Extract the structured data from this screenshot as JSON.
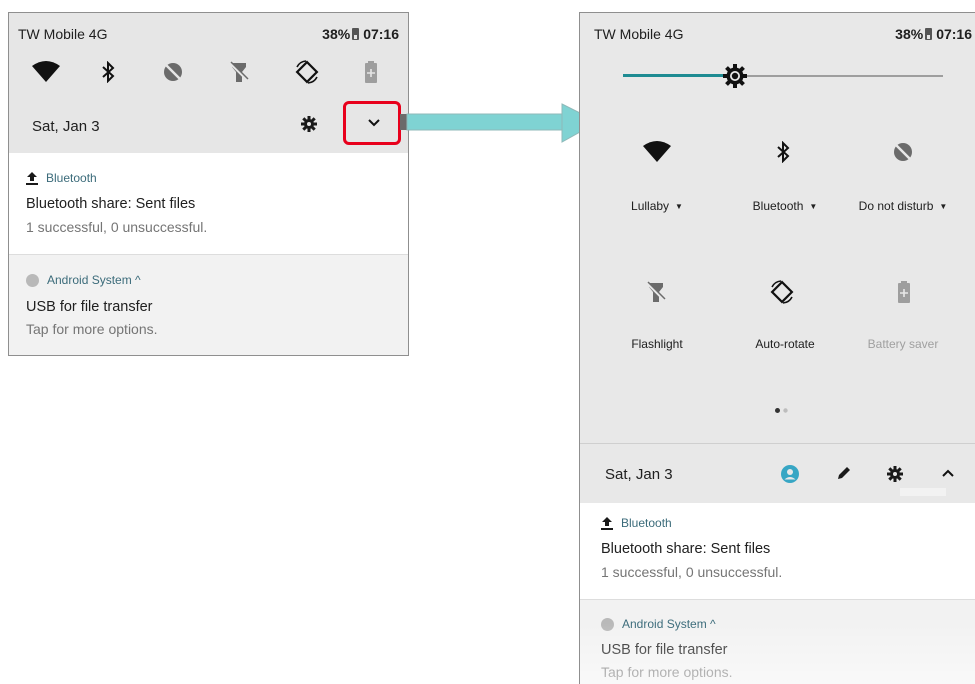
{
  "collapsed": {
    "carrier": "TW Mobile 4G",
    "battery": "38%",
    "time": "07:16",
    "date": "Sat, Jan 3",
    "quick_icons": [
      "wifi-icon",
      "bluetooth-icon",
      "dnd-icon",
      "flashlight-off-icon",
      "auto-rotate-icon",
      "battery-icon"
    ],
    "notifications": [
      {
        "app": "Bluetooth",
        "title": "Bluetooth share: Sent files",
        "body": "1 successful, 0 unsuccessful."
      },
      {
        "app": "Android System ^",
        "title": "USB for file transfer",
        "body": "Tap for more options."
      }
    ]
  },
  "expanded": {
    "carrier": "TW Mobile 4G",
    "battery": "38%",
    "time": "07:16",
    "tiles": [
      {
        "label": "Lullaby",
        "icon": "wifi-icon"
      },
      {
        "label": "Bluetooth",
        "icon": "bluetooth-icon"
      },
      {
        "label": "Do not disturb",
        "icon": "dnd-icon"
      },
      {
        "label": "Flashlight",
        "icon": "flashlight-off-icon"
      },
      {
        "label": "Auto-rotate",
        "icon": "auto-rotate-icon"
      },
      {
        "label": "Battery saver",
        "icon": "battery-icon"
      }
    ],
    "brightness": 0.35,
    "page_dots": 2,
    "date": "Sat, Jan 3",
    "notifications": [
      {
        "app": "Bluetooth",
        "title": "Bluetooth share: Sent files",
        "body": "1 successful, 0 unsuccessful."
      },
      {
        "app": "Android System ^",
        "title": "USB for file transfer",
        "body": "Tap for more options."
      }
    ]
  },
  "colors": {
    "highlight": "#e8001c",
    "arrow": "#7fd3d3",
    "accent": "#37a6c4",
    "slider": "#1e8b92"
  }
}
